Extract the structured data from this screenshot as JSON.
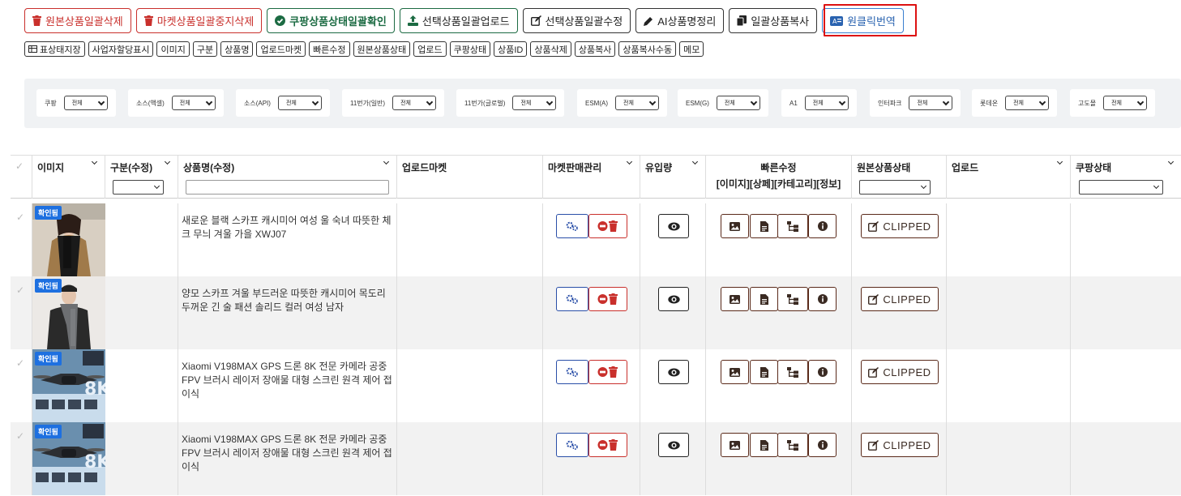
{
  "toolbar": {
    "buttons": [
      {
        "label": "원본상품일괄삭제",
        "icon": "trash-icon"
      },
      {
        "label": "마켓상품일괄중지삭제",
        "icon": "trash-icon"
      },
      {
        "label": "쿠팡상품상태일괄확인",
        "icon": "check-circle-icon"
      },
      {
        "label": "선택상품일괄업로드",
        "icon": "upload-icon"
      },
      {
        "label": "선택상품일괄수정",
        "icon": "edit-icon"
      },
      {
        "label": "AI상품명정리",
        "icon": "pencil-icon"
      },
      {
        "label": "일괄상품복사",
        "icon": "copy-icon"
      },
      {
        "label": "원클릭번역",
        "icon": "translate-icon"
      }
    ]
  },
  "columns_toggle": [
    "표상태지장",
    "사업자할당표시",
    "이미지",
    "구분",
    "상품명",
    "업로드마켓",
    "빠른수정",
    "원본상품상태",
    "업로드",
    "쿠팡상태",
    "상품ID",
    "상품삭제",
    "상품복사",
    "상품복사수동",
    "메모"
  ],
  "filters": [
    {
      "label": "쿠팡",
      "value": "전체"
    },
    {
      "label": "소스(액셀)",
      "value": "전체"
    },
    {
      "label": "소스(API)",
      "value": "전체"
    },
    {
      "label": "11번가(일반)",
      "value": "전체"
    },
    {
      "label": "11번가(글로벌)",
      "value": "전체"
    },
    {
      "label": "ESM(A)",
      "value": "전체"
    },
    {
      "label": "ESM(G)",
      "value": "전체"
    },
    {
      "label": "A1",
      "value": "전체"
    },
    {
      "label": "인터파크",
      "value": "전체"
    },
    {
      "label": "롯데온",
      "value": "전체"
    },
    {
      "label": "고도몰",
      "value": "전체"
    }
  ],
  "table": {
    "headers": {
      "image": "이미지",
      "category": "구분(수정)",
      "name": "상품명(수정)",
      "upload_market": "업로드마켓",
      "market_manage": "마켓판매관리",
      "traffic": "유입량",
      "quick_edit": "빠른수정",
      "quick_edit_sub": "[이미지][상페][카테고리][정보]",
      "source_status": "원본상품상태",
      "upload": "업로드",
      "coupang_status": "쿠팡상태"
    },
    "rows": [
      {
        "badge": "확인됨",
        "name": "새로운 블랙 스카프 캐시미어 여성 울 숙녀 따뜻한 체크 무늬 겨울 가을 XWJ07",
        "status": "CLIPPED"
      },
      {
        "badge": "확인됨",
        "name": "양모 스카프 겨울 부드러운 따뜻한 캐시미어 목도리 두꺼운 긴 술 패션 솔리드 컬러 여성 남자",
        "status": "CLIPPED"
      },
      {
        "badge": "확인됨",
        "name": "Xiaomi V198MAX GPS 드론 8K 전문 카메라 공중 FPV 브러시 레이저 장애물 대형 스크린 원격 제어 접이식",
        "status": "CLIPPED"
      },
      {
        "badge": "확인됨",
        "name": "Xiaomi V198MAX GPS 드론 8K 전문 카메라 공중 FPV 브러시 레이저 장애물 대형 스크린 원격 제어 접이식",
        "status": "CLIPPED"
      }
    ]
  },
  "colors": {
    "red": "#c9302c",
    "green": "#1c6b43",
    "blue": "#2a63b0",
    "badge": "#1e70e0",
    "highlight": "#dd1111"
  }
}
